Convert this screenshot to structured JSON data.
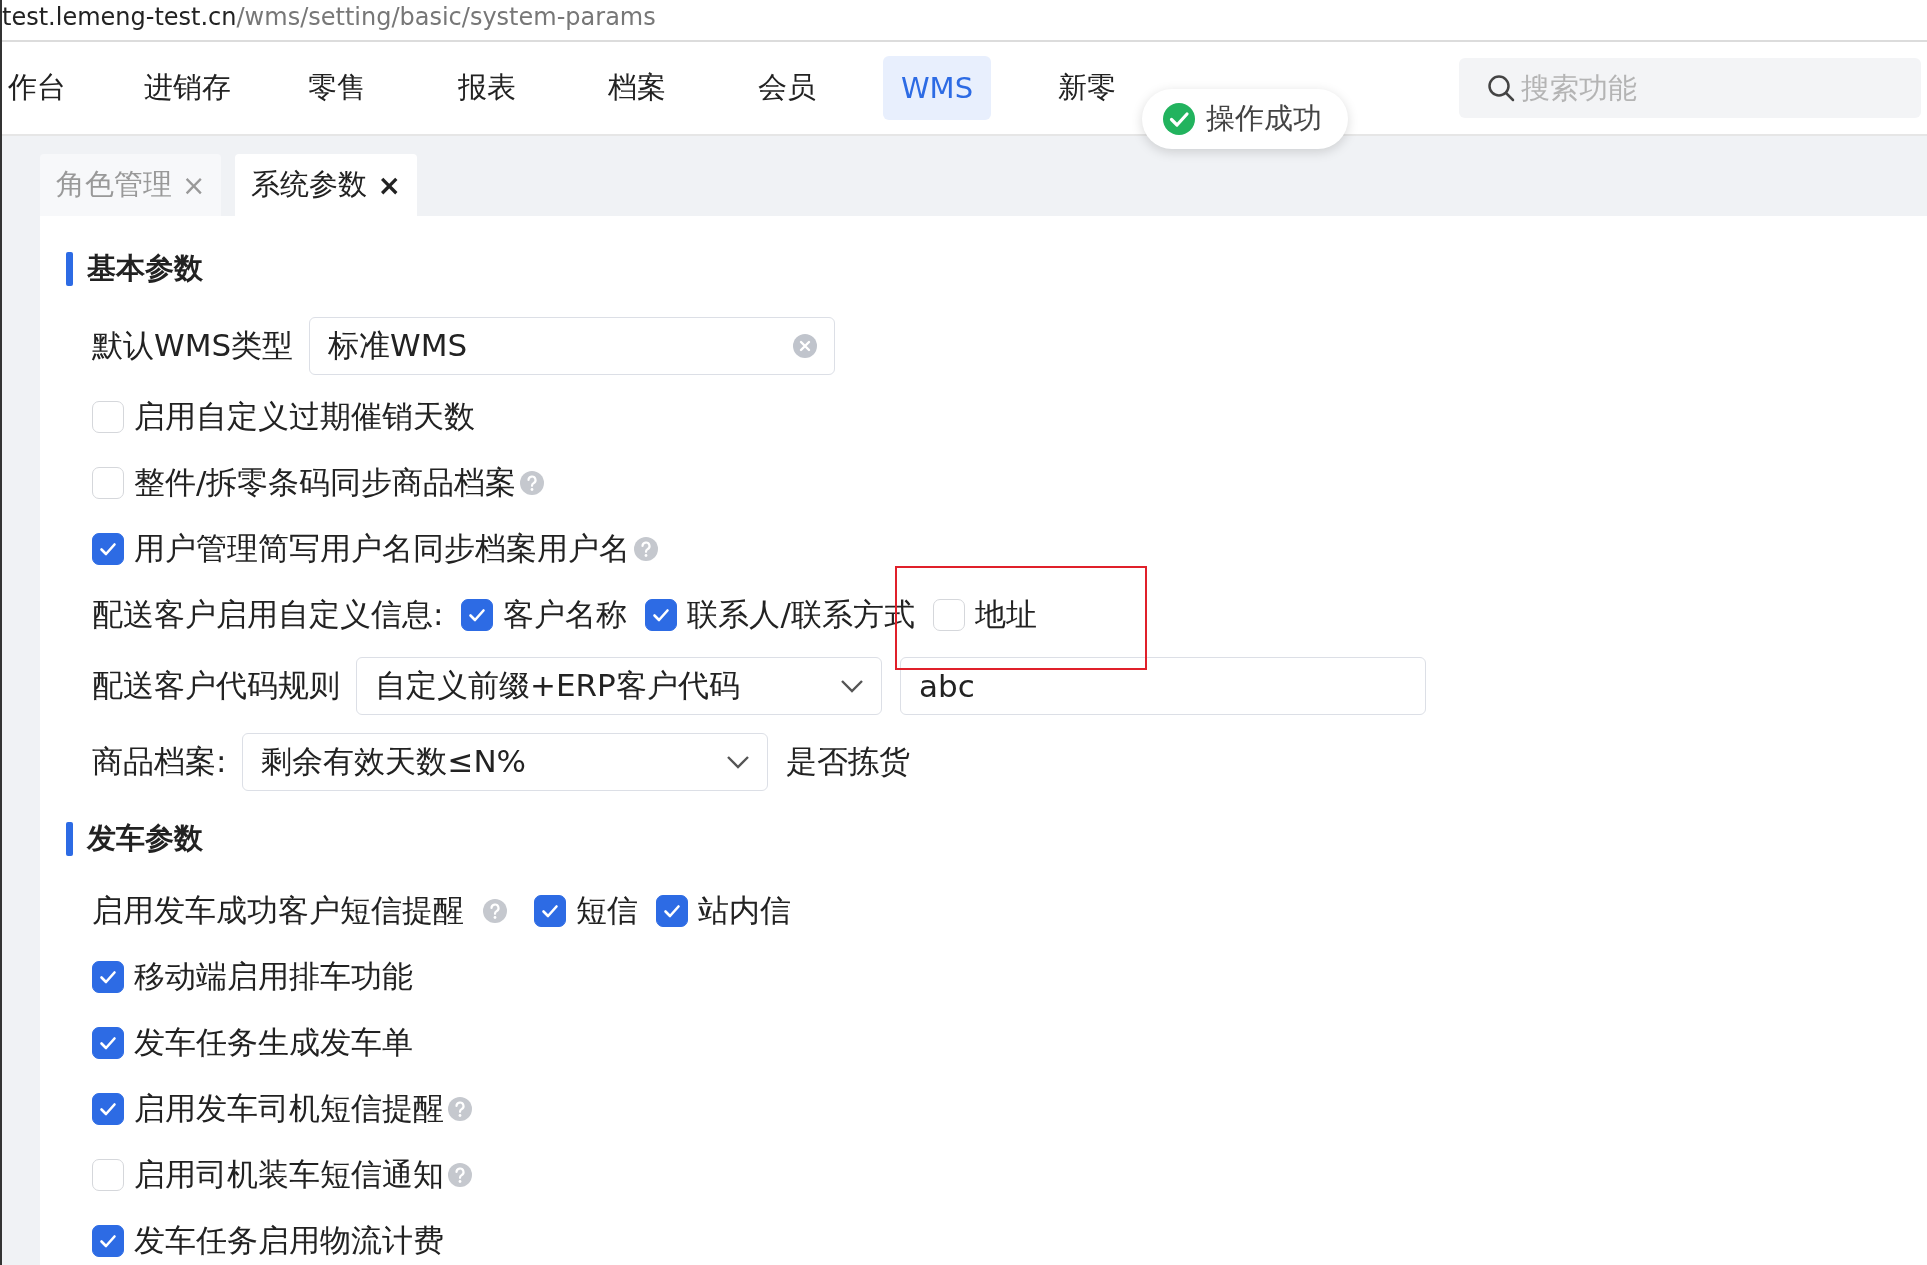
{
  "address_bar": {
    "host": "test.lemeng-test.cn",
    "path": "/wms/setting/basic/system-params"
  },
  "nav": {
    "items": [
      {
        "label": "作台",
        "selected": false
      },
      {
        "label": "进销存",
        "selected": false
      },
      {
        "label": "零售",
        "selected": false
      },
      {
        "label": "报表",
        "selected": false
      },
      {
        "label": "档案",
        "selected": false
      },
      {
        "label": "会员",
        "selected": false
      },
      {
        "label": "WMS",
        "selected": true
      },
      {
        "label": "新零",
        "selected": false
      }
    ],
    "search": {
      "placeholder": "搜索功能"
    }
  },
  "toast": {
    "message": "操作成功"
  },
  "tabs": [
    {
      "label": "角色管理",
      "close": "×",
      "selected": false
    },
    {
      "label": "系统参数",
      "close": "×",
      "selected": true
    }
  ],
  "sections": [
    {
      "title": "基本参数",
      "rows": [
        {
          "kind": "field",
          "label": "默认WMS类型",
          "value": "标准WMS",
          "clearable": true
        },
        {
          "kind": "checkbox",
          "label": "启用自定义过期催销天数",
          "checked": false,
          "help": false
        },
        {
          "kind": "checkbox",
          "label": "整件/拆零条码同步商品档案",
          "checked": false,
          "help": true
        },
        {
          "kind": "checkbox",
          "label": "用户管理简写用户名同步档案用户名",
          "checked": true,
          "help": true
        },
        {
          "kind": "options",
          "label": "配送客户启用自定义信息:",
          "help": false,
          "options": [
            {
              "label": "客户名称",
              "checked": true
            },
            {
              "label": "联系人/联系方式",
              "checked": true
            },
            {
              "label": "地址",
              "checked": false
            }
          ]
        },
        {
          "kind": "select_input",
          "label": "配送客户代码规则",
          "value": "自定义前缀+ERP客户代码",
          "input": "abc"
        },
        {
          "kind": "select_text",
          "label": "商品档案:",
          "value": "剩余有效天数≤N%",
          "suffix": "是否拣货"
        }
      ]
    },
    {
      "title": "发车参数",
      "rows": [
        {
          "kind": "options",
          "label": "启用发车成功客户短信提醒",
          "help": true,
          "options": [
            {
              "label": "短信",
              "checked": true
            },
            {
              "label": "站内信",
              "checked": true
            }
          ]
        },
        {
          "kind": "checkbox",
          "label": "移动端启用排车功能",
          "checked": true,
          "help": false
        },
        {
          "kind": "checkbox",
          "label": "发车任务生成发车单",
          "checked": true,
          "help": false
        },
        {
          "kind": "checkbox",
          "label": "启用发车司机短信提醒",
          "checked": true,
          "help": true
        },
        {
          "kind": "checkbox",
          "label": "启用司机装车短信通知",
          "checked": false,
          "help": true
        },
        {
          "kind": "checkbox",
          "label": "发车任务启用物流计费",
          "checked": true,
          "help": false
        }
      ]
    }
  ]
}
